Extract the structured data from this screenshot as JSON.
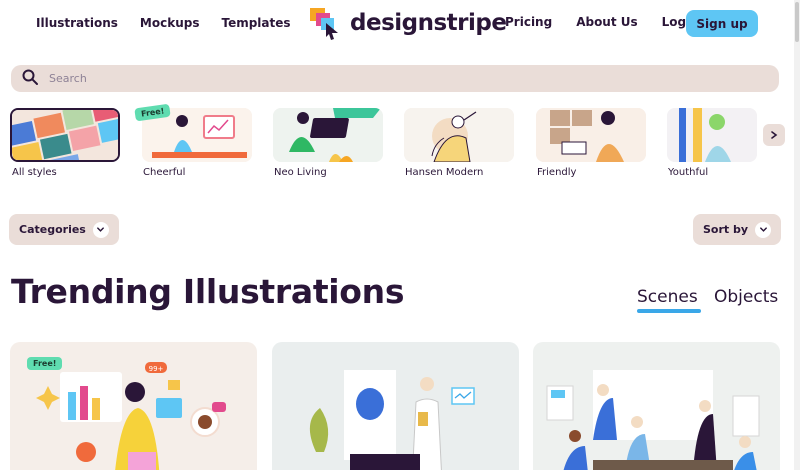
{
  "header": {
    "nav_left": [
      "Illustrations",
      "Mockups",
      "Templates"
    ],
    "logo_text": "designstripe",
    "nav_right": [
      "Pricing",
      "About Us",
      "Log in"
    ],
    "signup_label": "Sign up"
  },
  "search": {
    "placeholder": "Search"
  },
  "styles": {
    "items": [
      {
        "label": "All styles"
      },
      {
        "label": "Cheerful",
        "badge": "Free!"
      },
      {
        "label": "Neo Living"
      },
      {
        "label": "Hansen Modern"
      },
      {
        "label": "Friendly"
      },
      {
        "label": "Youthful"
      }
    ],
    "next_icon": "chevron-right-icon"
  },
  "filters": {
    "categories_label": "Categories",
    "sort_label": "Sort by"
  },
  "main": {
    "title": "Trending Illustrations",
    "tabs": [
      {
        "label": "Scenes",
        "active": true
      },
      {
        "label": "Objects",
        "active": false
      }
    ],
    "cards": [
      {
        "badge": "Free!",
        "bubble": "99+"
      },
      {
        "badge": ""
      },
      {
        "badge": ""
      }
    ]
  },
  "colors": {
    "accent": "#5ec6f4",
    "text": "#2a1638",
    "panel": "#eaddd8",
    "free_badge": "#5fdcb0",
    "tab_underline": "#3aa7e8"
  }
}
